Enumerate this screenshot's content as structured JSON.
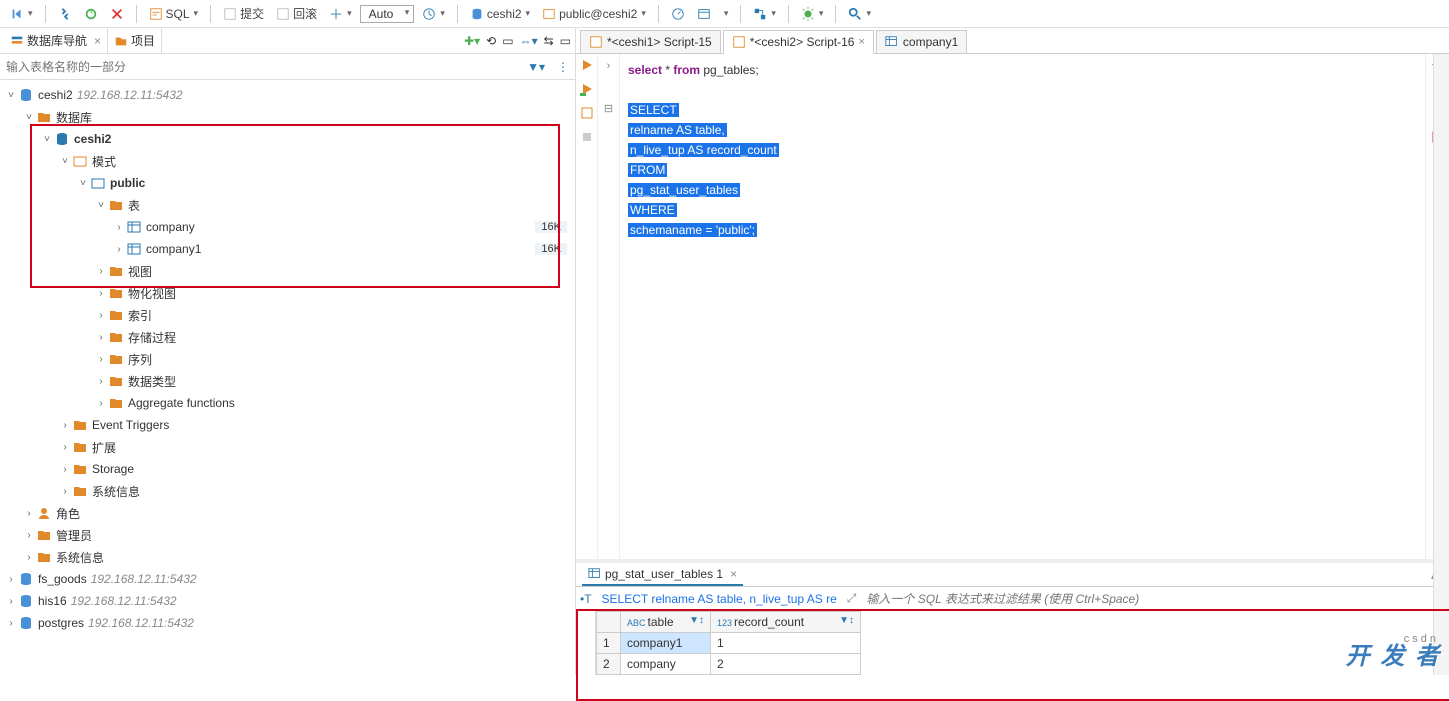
{
  "toolbar": {
    "sql_label": "SQL",
    "commit_label": "提交",
    "rollback_label": "回滚",
    "mode_combo": "Auto",
    "conn1": "ceshi2",
    "conn2": "public@ceshi2"
  },
  "left": {
    "tab_nav": "数据库导航",
    "tab_proj": "项目",
    "filter_placeholder": "输入表格名称的一部分",
    "tree": {
      "conn": "ceshi2",
      "conn_addr": "192.168.12.11:5432",
      "db_group": "数据库",
      "db": "ceshi2",
      "schema_group": "模式",
      "schema": "public",
      "tables_group": "表",
      "table1": "company",
      "table1_size": "16K",
      "table2": "company1",
      "table2_size": "16K",
      "views": "视图",
      "mviews": "物化视图",
      "indexes": "索引",
      "procs": "存储过程",
      "seqs": "序列",
      "dtypes": "数据类型",
      "aggs": "Aggregate functions",
      "evt": "Event Triggers",
      "ext": "扩展",
      "storage": "Storage",
      "sysinfo": "系统信息",
      "roles": "角色",
      "admin": "管理员",
      "sysinfo2": "系统信息",
      "fs_goods": "fs_goods",
      "fs_goods_addr": "192.168.12.11:5432",
      "his16": "his16",
      "his16_addr": "192.168.12.11:5432",
      "postgres": "postgres",
      "postgres_addr": "192.168.12.11:5432"
    }
  },
  "editor": {
    "tab1": "*<ceshi1> Script-15",
    "tab2": "*<ceshi2> Script-16",
    "tab3": "company1",
    "code_first": {
      "l": "select",
      "s": " * ",
      "f": "from",
      "t": " pg_tables;"
    },
    "sel_lines": [
      "SELECT",
      "    relname AS table,",
      "    n_live_tup AS record_count",
      "FROM",
      "    pg_stat_user_tables",
      "WHERE",
      "    schemaname = 'public';"
    ]
  },
  "result": {
    "tab": "pg_stat_user_tables 1",
    "sqlprev": "SELECT relname AS table, n_live_tup AS re",
    "filter_placeholder": "输入一个 SQL 表达式来过滤结果 (使用 Ctrl+Space)",
    "cols": {
      "c1": "table",
      "c2": "record_count"
    },
    "rows": [
      {
        "n": "1",
        "table": "company1",
        "count": "1"
      },
      {
        "n": "2",
        "table": "company",
        "count": "2"
      }
    ]
  },
  "watermark": {
    "sub": "csdn",
    "main": "开 发 者"
  }
}
